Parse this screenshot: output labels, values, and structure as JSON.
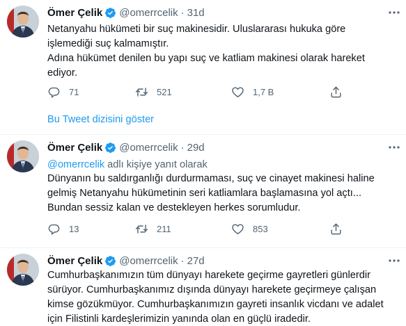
{
  "colors": {
    "accent": "#1d9bf0",
    "muted": "#536471",
    "text": "#0f1419",
    "verified": "#1d9bf0"
  },
  "show_thread": "Bu Tweet dizisini göster",
  "tweets": [
    {
      "name": "Ömer Çelik",
      "handle": "@omerrcelik",
      "sep": "·",
      "time": "31d",
      "lines": [
        "Netanyahu hükümeti bir suç makinesidir. Uluslararası hukuka göre",
        "işlemediği suç kalmamıştır.",
        "Adına hükümet denilen bu yapı suç ve katliam makinesi olarak hareket",
        "ediyor."
      ],
      "replies": "71",
      "retweets": "521",
      "likes": "1,7 B"
    },
    {
      "name": "Ömer Çelik",
      "handle": "@omerrcelik",
      "sep": "·",
      "time": "29d",
      "replying_mention": "@omerrcelik",
      "replying_text": " adlı kişiye yanıt olarak",
      "lines": [
        "Dünyanın bu saldırganlığı durdurmaması, suç ve cinayet makinesi haline",
        "gelmiş Netanyahu hükümetinin seri katliamlara başlamasına yol açtı...",
        "Bundan sessiz kalan ve destekleyen herkes sorumludur."
      ],
      "replies": "13",
      "retweets": "211",
      "likes": "853"
    },
    {
      "name": "Ömer Çelik",
      "handle": "@omerrcelik",
      "sep": "·",
      "time": "27d",
      "lines": [
        "Cumhurbaşkanımızın tüm dünyayı harekete geçirme gayretleri günlerdir",
        "sürüyor. Cumhurbaşkanımız dışında dünyayı harekete geçirmeye çalışan",
        "kimse gözükmüyor. Cumhurbaşkanımızın gayreti insanlık vicdanı ve adalet",
        "için Filistinli kardeşlerimizin yanında olan en güçlü iradedir."
      ]
    }
  ]
}
